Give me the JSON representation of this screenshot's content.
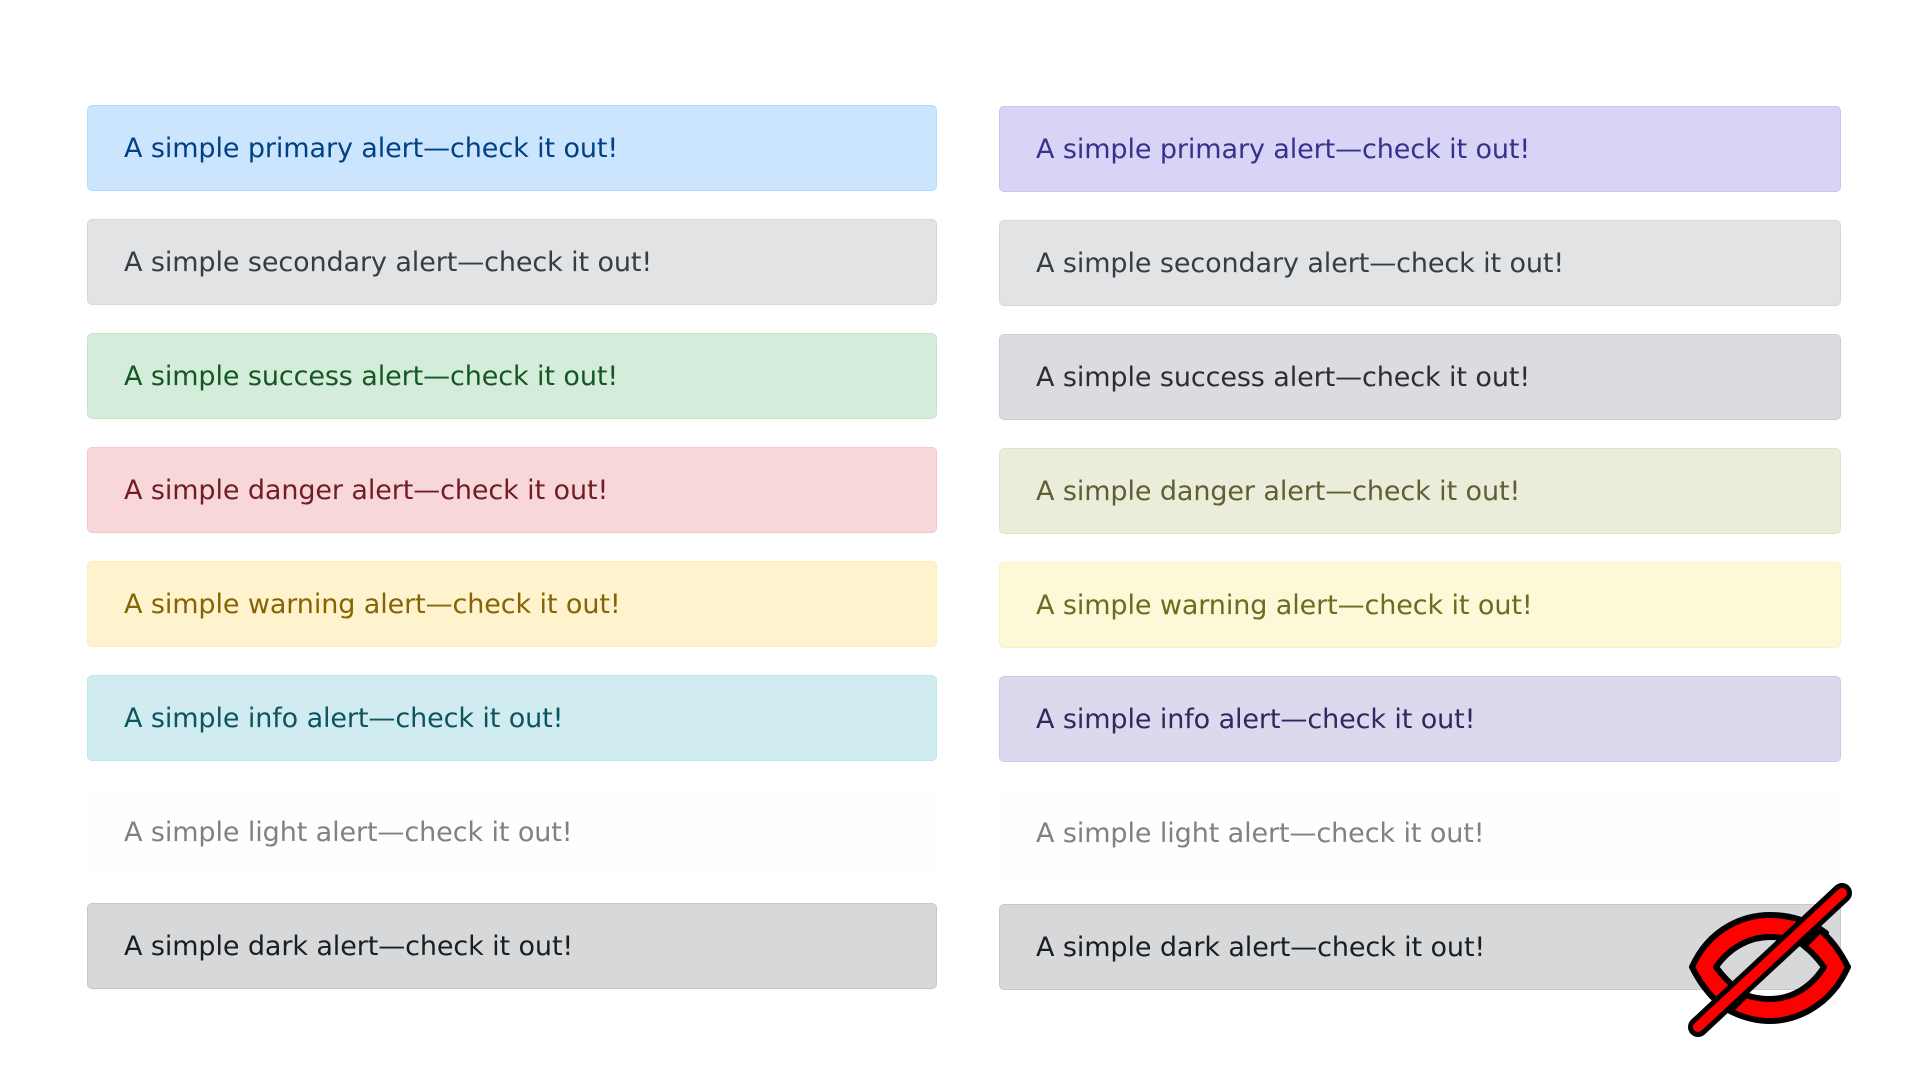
{
  "left_column": {
    "alerts": [
      {
        "text": "A simple primary alert—check it out!",
        "bg": "#cce5ff",
        "border": "#b8daff",
        "fg": "#004085"
      },
      {
        "text": "A simple secondary alert—check it out!",
        "bg": "#e2e3e5",
        "border": "#d6d8db",
        "fg": "#383d41"
      },
      {
        "text": "A simple success alert—check it out!",
        "bg": "#d4edda",
        "border": "#c3e6cb",
        "fg": "#155724"
      },
      {
        "text": "A simple danger alert—check it out!",
        "bg": "#f8d7da",
        "border": "#f5c6cb",
        "fg": "#721c24"
      },
      {
        "text": "A simple warning alert—check it out!",
        "bg": "#fff3cd",
        "border": "#ffeeba",
        "fg": "#856404"
      },
      {
        "text": "A simple info alert—check it out!",
        "bg": "#d1ecf1",
        "border": "#bee5eb",
        "fg": "#0c5460"
      },
      {
        "text": "A simple light alert—check it out!",
        "bg": "#fefefe",
        "border": "#fdfdfe",
        "fg": "#818182"
      },
      {
        "text": "A simple dark alert—check it out!",
        "bg": "#d6d8d9",
        "border": "#c6c8ca",
        "fg": "#1b1e21"
      }
    ]
  },
  "right_column": {
    "alerts": [
      {
        "text": "A simple primary alert—check it out!",
        "bg": "#d7d4f6",
        "border": "#c9c5f1",
        "fg": "#3a2f8a"
      },
      {
        "text": "A simple secondary alert—check it out!",
        "bg": "#e2e3e5",
        "border": "#d6d8db",
        "fg": "#383d41"
      },
      {
        "text": "A simple success alert—check it out!",
        "bg": "#dddae0",
        "border": "#d0ccd4",
        "fg": "#2f2c35"
      },
      {
        "text": "A simple danger alert—check it out!",
        "bg": "#ebedda",
        "border": "#e1e4c8",
        "fg": "#5c6033"
      },
      {
        "text": "A simple warning alert—check it out!",
        "bg": "#fbf9d8",
        "border": "#f6f3c1",
        "fg": "#6e6a1e"
      },
      {
        "text": "A simple info alert—check it out!",
        "bg": "#dcd8ee",
        "border": "#cfcae7",
        "fg": "#2d2a5e"
      },
      {
        "text": "A simple light alert—check it out!",
        "bg": "#fefefe",
        "border": "#fdfdfe",
        "fg": "#818182"
      },
      {
        "text": "A simple dark alert—check it out!",
        "bg": "#d6d8d9",
        "border": "#c6c8ca",
        "fg": "#1b1e21"
      }
    ]
  },
  "overlay": {
    "icon": "eye-slash-icon",
    "color": "#ff0000"
  }
}
